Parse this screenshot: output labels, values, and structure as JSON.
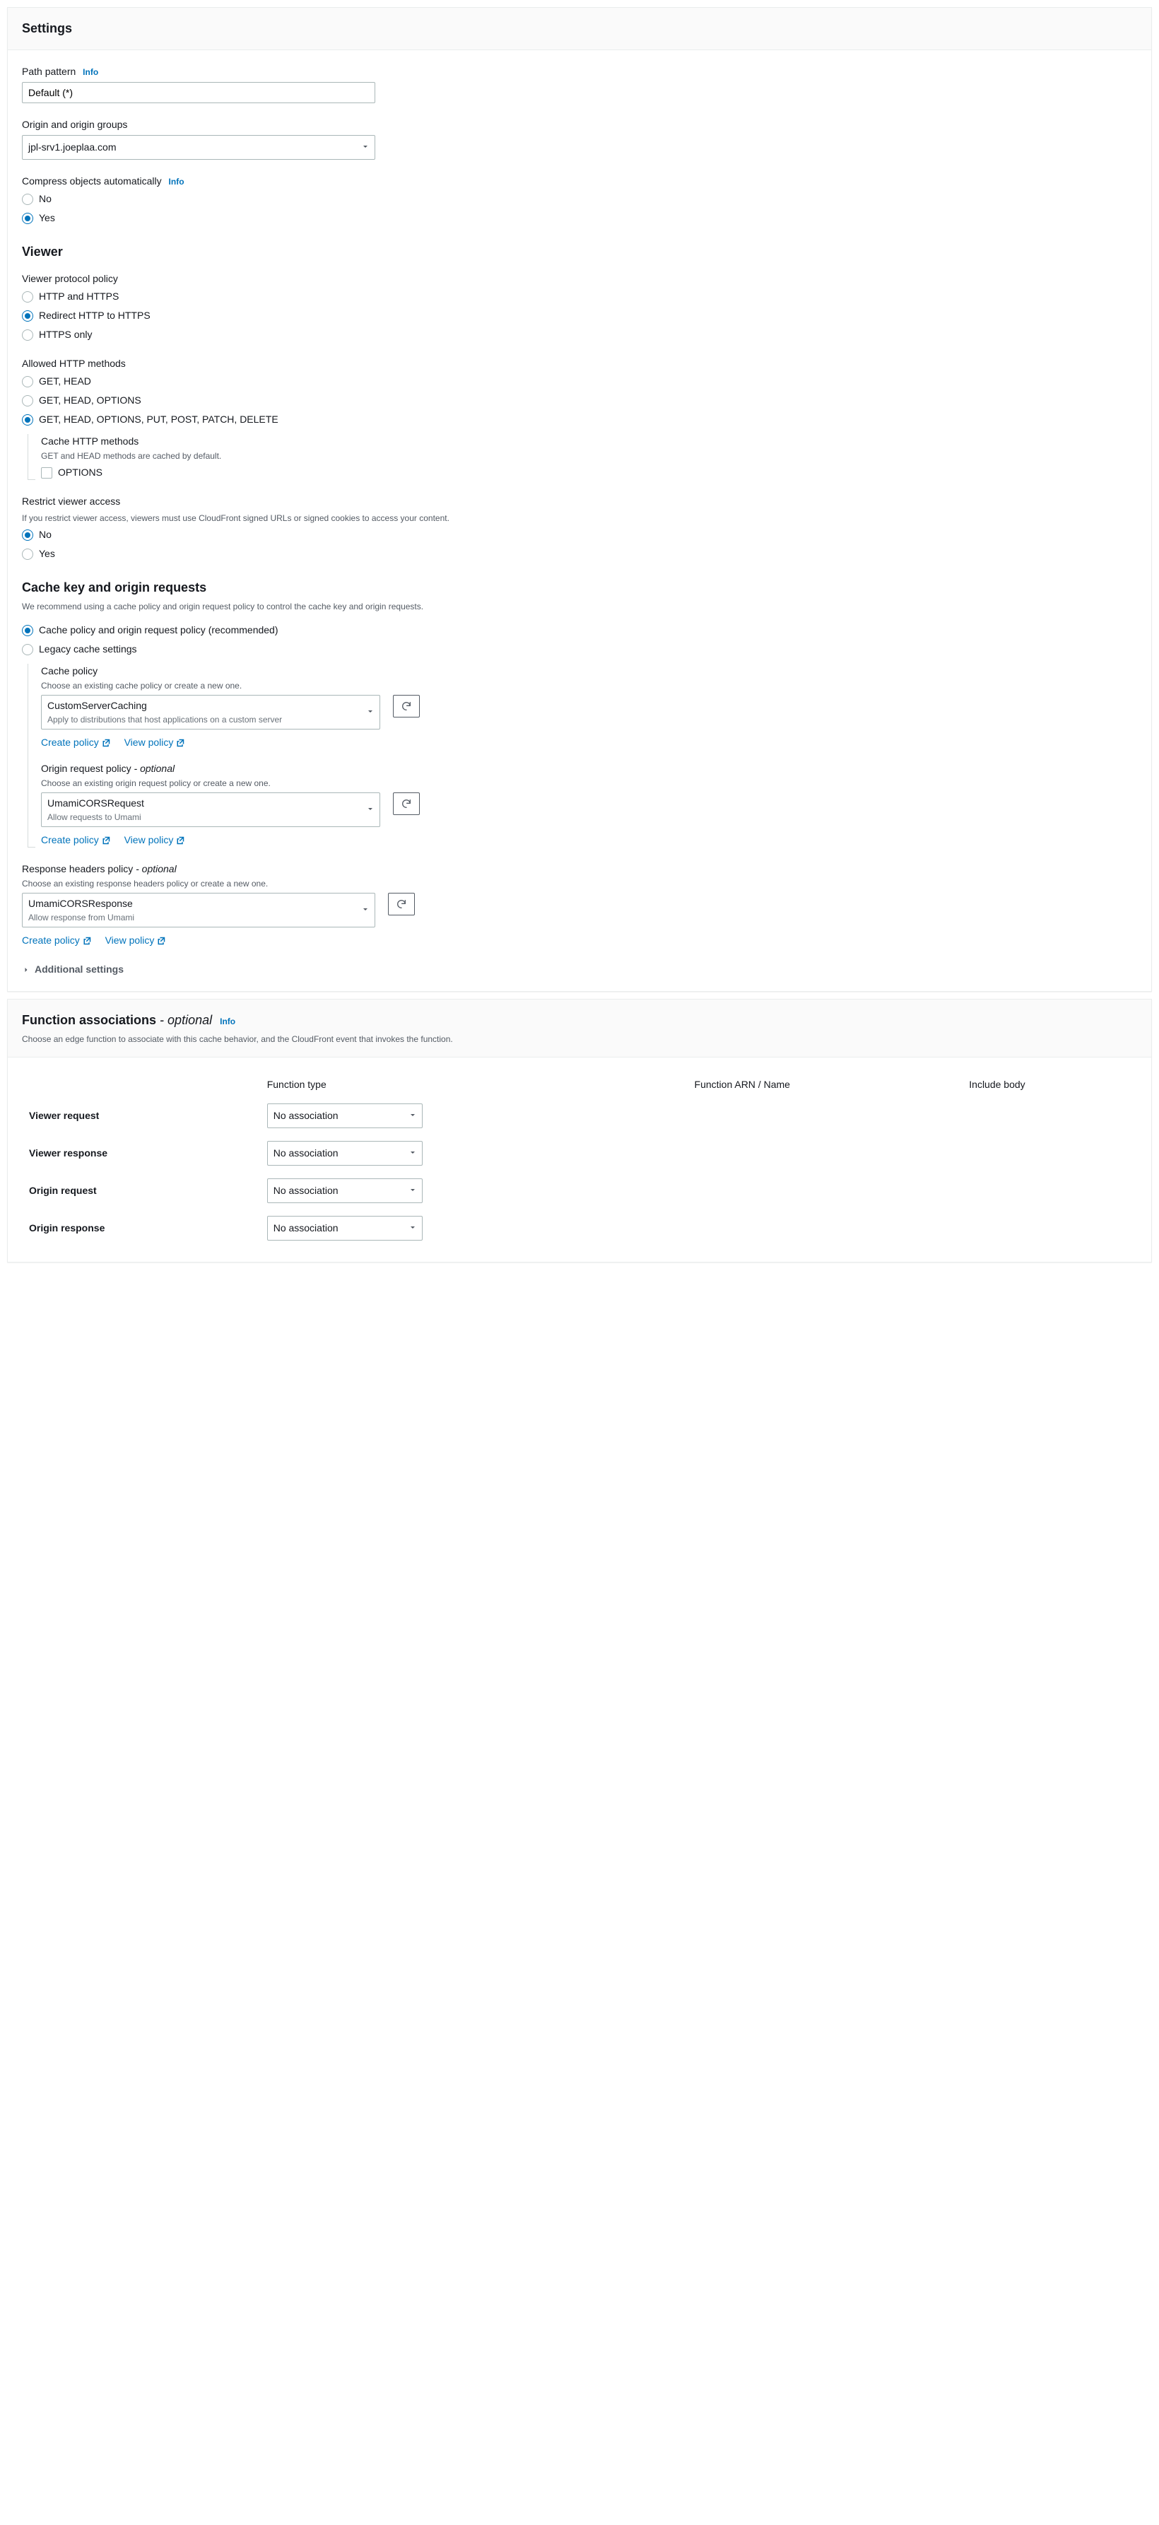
{
  "settings": {
    "title": "Settings",
    "pathPattern": {
      "label": "Path pattern",
      "info": "Info",
      "value": "Default (*)"
    },
    "origin": {
      "label": "Origin and origin groups",
      "value": "jpl-srv1.joeplaa.com"
    },
    "compress": {
      "label": "Compress objects automatically",
      "info": "Info",
      "options": [
        "No",
        "Yes"
      ],
      "selected": "Yes"
    },
    "viewer": {
      "heading": "Viewer",
      "protocol": {
        "label": "Viewer protocol policy",
        "options": [
          "HTTP and HTTPS",
          "Redirect HTTP to HTTPS",
          "HTTPS only"
        ],
        "selected": "Redirect HTTP to HTTPS"
      },
      "methods": {
        "label": "Allowed HTTP methods",
        "options": [
          "GET, HEAD",
          "GET, HEAD, OPTIONS",
          "GET, HEAD, OPTIONS, PUT, POST, PATCH, DELETE"
        ],
        "selected": "GET, HEAD, OPTIONS, PUT, POST, PATCH, DELETE",
        "cacheMethods": {
          "label": "Cache HTTP methods",
          "desc": "GET and HEAD methods are cached by default.",
          "option": "OPTIONS"
        }
      },
      "restrict": {
        "label": "Restrict viewer access",
        "desc": "If you restrict viewer access, viewers must use CloudFront signed URLs or signed cookies to access your content.",
        "options": [
          "No",
          "Yes"
        ],
        "selected": "No"
      }
    },
    "cacheKey": {
      "heading": "Cache key and origin requests",
      "desc": "We recommend using a cache policy and origin request policy to control the cache key and origin requests.",
      "policyOptions": [
        "Cache policy and origin request policy (recommended)",
        "Legacy cache settings"
      ],
      "policySelected": "Cache policy and origin request policy (recommended)",
      "cachePolicy": {
        "label": "Cache policy",
        "desc": "Choose an existing cache policy or create a new one.",
        "value": "CustomServerCaching",
        "sub": "Apply to distributions that host applications on a custom server"
      },
      "originRequestPolicy": {
        "label": "Origin request policy",
        "optional": "- optional",
        "desc": "Choose an existing origin request policy or create a new one.",
        "value": "UmamiCORSRequest",
        "sub": "Allow requests to Umami"
      },
      "responseHeadersPolicy": {
        "label": "Response headers policy",
        "optional": "- optional",
        "desc": "Choose an existing response headers policy or create a new one.",
        "value": "UmamiCORSResponse",
        "sub": "Allow response from Umami"
      },
      "createPolicy": "Create policy",
      "viewPolicy": "View policy",
      "additional": "Additional settings"
    }
  },
  "functions": {
    "title": "Function associations",
    "optional": "- optional",
    "info": "Info",
    "desc": "Choose an edge function to associate with this cache behavior, and the CloudFront event that invokes the function.",
    "headers": [
      "",
      "Function type",
      "Function ARN / Name",
      "Include body"
    ],
    "rows": [
      {
        "label": "Viewer request",
        "value": "No association"
      },
      {
        "label": "Viewer response",
        "value": "No association"
      },
      {
        "label": "Origin request",
        "value": "No association"
      },
      {
        "label": "Origin response",
        "value": "No association"
      }
    ]
  }
}
